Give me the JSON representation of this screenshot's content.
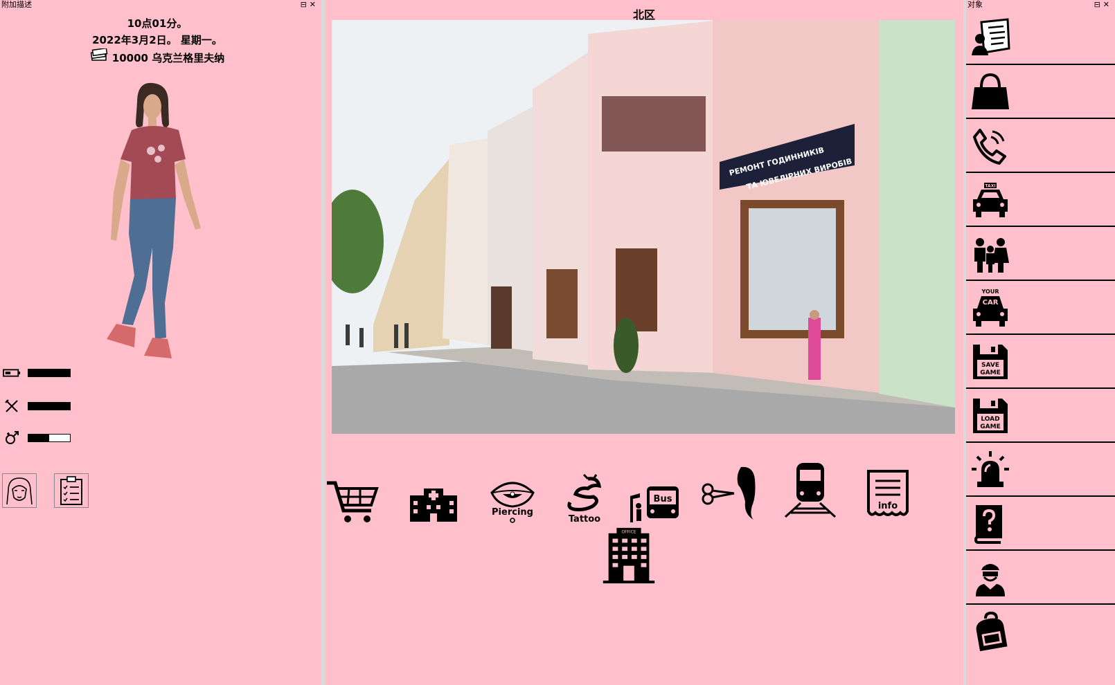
{
  "left_panel": {
    "title": "附加描述",
    "time": "10点01分。",
    "date": "2022年3月2日。 星期一。",
    "money": "10000 乌克兰格里夫纳",
    "stats": [
      {
        "icon": "battery-icon",
        "level": 1.0
      },
      {
        "icon": "fork-knife-icon",
        "level": 1.0
      },
      {
        "icon": "gender-icon",
        "level": 0.5
      }
    ],
    "buttons": [
      {
        "icon": "girl-face-icon"
      },
      {
        "icon": "checklist-icon"
      }
    ]
  },
  "center_panel": {
    "location": "北区",
    "scene": "street-photo",
    "nav": [
      {
        "icon": "shopping-cart-icon"
      },
      {
        "icon": "hospital-icon"
      },
      {
        "icon": "piercing-icon",
        "label": "Piercing"
      },
      {
        "icon": "tattoo-dragon-icon",
        "label": "Tattoo"
      },
      {
        "icon": "bus-stop-icon",
        "label": "Bus"
      },
      {
        "icon": "hair-salon-icon"
      },
      {
        "icon": "train-icon"
      },
      {
        "icon": "info-sign-icon",
        "label": "info"
      },
      {
        "icon": "office-building-icon",
        "label": "OFFICE"
      }
    ]
  },
  "right_panel": {
    "title": "对象",
    "items": [
      {
        "icon": "id-card-icon"
      },
      {
        "icon": "handbag-icon"
      },
      {
        "icon": "phone-icon"
      },
      {
        "icon": "taxi-icon",
        "label": "TAXI"
      },
      {
        "icon": "family-icon"
      },
      {
        "icon": "your-car-icon",
        "label1": "YOUR",
        "label2": "CAR"
      },
      {
        "icon": "save-game-icon",
        "label1": "SAVE",
        "label2": "GAME"
      },
      {
        "icon": "load-game-icon",
        "label1": "LOAD",
        "label2": "GAME"
      },
      {
        "icon": "alarm-siren-icon"
      },
      {
        "icon": "help-book-icon"
      },
      {
        "icon": "thief-icon"
      },
      {
        "icon": "backpack-icon"
      }
    ]
  },
  "colors": {
    "panel_bg": "#ffc0cb",
    "separator": "#d9d9d9",
    "icon": "#000000"
  }
}
